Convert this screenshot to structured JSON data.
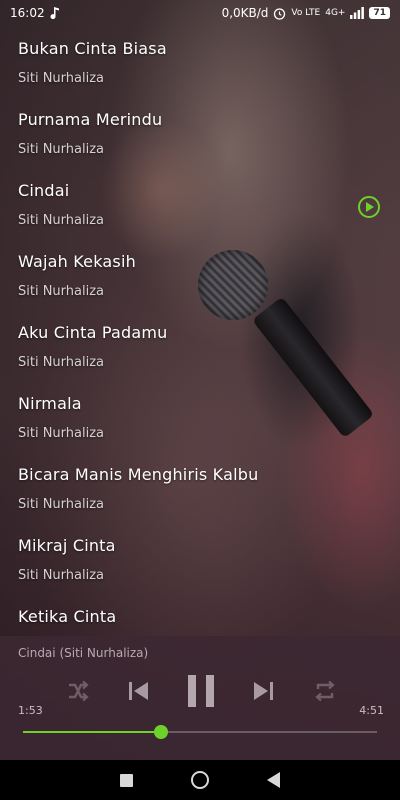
{
  "status_bar": {
    "time": "16:02",
    "network_speed": "0,0KB/d",
    "signal_label": "4G+",
    "volte_label": "Vo LTE",
    "battery": "71",
    "icons": [
      "music-note-icon",
      "alarm-icon",
      "signal-icon",
      "battery-icon"
    ]
  },
  "songs": [
    {
      "title": "Bukan Cinta Biasa",
      "artist": "Siti Nurhaliza",
      "playing": false
    },
    {
      "title": "Purnama Merindu",
      "artist": "Siti Nurhaliza",
      "playing": false
    },
    {
      "title": "Cindai",
      "artist": "Siti Nurhaliza",
      "playing": true
    },
    {
      "title": "Wajah Kekasih",
      "artist": "Siti Nurhaliza",
      "playing": false
    },
    {
      "title": "Aku Cinta Padamu",
      "artist": "Siti Nurhaliza",
      "playing": false
    },
    {
      "title": "Nirmala",
      "artist": "Siti Nurhaliza",
      "playing": false
    },
    {
      "title": "Bicara Manis Menghiris Kalbu",
      "artist": "Siti Nurhaliza",
      "playing": false
    },
    {
      "title": "Mikraj Cinta",
      "artist": "Siti Nurhaliza",
      "playing": false
    },
    {
      "title": "Ketika Cinta",
      "artist": "",
      "playing": false
    }
  ],
  "player": {
    "now_playing": "Cindai (Siti Nurhaliza)",
    "elapsed": "1:53",
    "total": "4:51",
    "progress": 0.39,
    "controls": [
      "shuffle-icon",
      "previous-icon",
      "pause-icon",
      "next-icon",
      "repeat-icon"
    ]
  },
  "colors": {
    "accent": "#6ed12a",
    "panel": "#3c2832"
  },
  "navbar": {
    "icons": [
      "recents-icon",
      "home-icon",
      "back-icon"
    ]
  }
}
